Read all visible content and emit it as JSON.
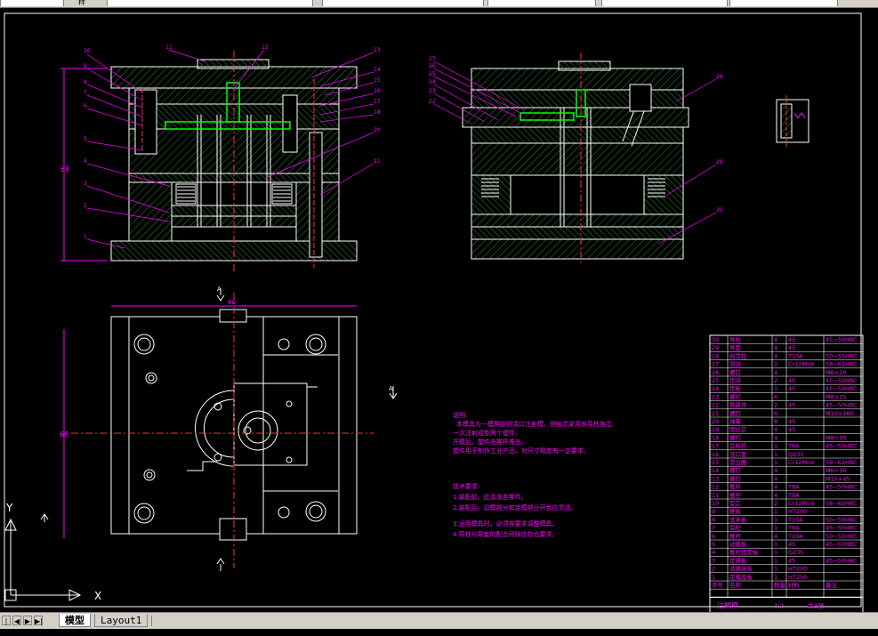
{
  "toolbar": {
    "fragment_label": "样"
  },
  "tabs": [
    {
      "label": "模型"
    },
    {
      "label": "Layout1"
    }
  ],
  "nav_buttons": [
    "|◀",
    "◀",
    "▶",
    "▶|"
  ],
  "ucs": {
    "x_label": "X",
    "y_label": "Y"
  },
  "drawing": {
    "notes_title": "说明:",
    "notes_body": [
      "本模具为一模两腔侧浇口注射模，侧抽芯采用斜导柱抽芯,",
      "一次注射成型两个塑件;",
      "开模后，塑件由推杆推出。",
      "塑件用于制作工业产品，对尺寸精度有一定要求。"
    ],
    "tech_title": "技术要求:",
    "tech_items": [
      "1.装配前，应清洗各零件。",
      "2.装配后，动模部分和定模部分开合应灵活。",
      "3.运用模具时，必须按要求调整模具。",
      "4.导柱与导套的配合间隙应符合要求。"
    ],
    "section_labels": [
      "A",
      "A"
    ],
    "part_numbers_left": [
      "10",
      "9",
      "8",
      "7",
      "6",
      "5",
      "4",
      "3",
      "2",
      "1"
    ],
    "part_numbers_top": [
      "11",
      "12",
      "13"
    ],
    "part_numbers_right": [
      "14",
      "15",
      "16",
      "17",
      "18",
      "19",
      "20",
      "21"
    ],
    "part_numbers_mid": [
      "27",
      "26",
      "25",
      "24",
      "23",
      "22"
    ],
    "part_numbers_mid_right": [
      "28",
      "29",
      "30"
    ]
  },
  "bom": {
    "rows": [
      [
        "30",
        "导柱",
        "4",
        "45",
        "45~50HRC"
      ],
      [
        "29",
        "导套",
        "4",
        "45",
        ""
      ],
      [
        "28",
        "斜导柱",
        "4",
        "T10A",
        "50~55HRC"
      ],
      [
        "27",
        "滑块",
        "2",
        "Cr12MoV",
        "58~62HRC"
      ],
      [
        "26",
        "螺钉",
        "4",
        "",
        "M6×20"
      ],
      [
        "25",
        "垫块",
        "2",
        "45",
        "45~50HRC"
      ],
      [
        "24",
        "垫板",
        "1",
        "45",
        "45~50HRC"
      ],
      [
        "23",
        "螺钉",
        "6",
        "",
        "M8×15"
      ],
      [
        "22",
        "楔紧块",
        "2",
        "45",
        "45~50HRC"
      ],
      [
        "21",
        "螺钉",
        "6",
        "",
        "M10×160"
      ],
      [
        "20",
        "弹簧",
        "8",
        "45",
        ""
      ],
      [
        "19",
        "限位钉",
        "4",
        "45",
        ""
      ],
      [
        "18",
        "螺钉",
        "4",
        "",
        "M8×30"
      ],
      [
        "17",
        "拉料杆",
        "1",
        "T8A",
        "45~50HRC"
      ],
      [
        "16",
        "浇口套",
        "1",
        "Q235",
        ""
      ],
      [
        "15",
        "定位圈",
        "1",
        "Cr12MoV",
        "58~62HRC"
      ],
      [
        "14",
        "螺钉",
        "4",
        "",
        "M6×30"
      ],
      [
        "13",
        "螺钉",
        "4",
        "",
        "M10×45"
      ],
      [
        "12",
        "推杆",
        "4",
        "T8A",
        "45~50HRC"
      ],
      [
        "11",
        "推杆",
        "4",
        "T8A",
        ""
      ],
      [
        "10",
        "型芯",
        "2",
        "Cr12MoV",
        "58~62HRC"
      ],
      [
        "9",
        "推板",
        "1",
        "HT200",
        ""
      ],
      [
        "8",
        "支承板",
        "1",
        "T10A",
        "50~55HRC"
      ],
      [
        "7",
        "型腔",
        "1",
        "T8A",
        "45~50HRC"
      ],
      [
        "6",
        "推杆",
        "4",
        "T10A",
        "50~55HRC"
      ],
      [
        "5",
        "动模板",
        "1",
        "45",
        "45~50HRC"
      ],
      [
        "4",
        "推杆固定板",
        "1",
        "Q235",
        ""
      ],
      [
        "3",
        "定模板",
        "1",
        "45",
        "45~50HRC"
      ],
      [
        "2",
        "动模座板",
        "1",
        "HT200",
        ""
      ],
      [
        "1",
        "定模座板",
        "1",
        "HT200",
        ""
      ]
    ],
    "header": [
      "序号",
      "名称",
      "数量",
      "材料",
      "备注"
    ],
    "title_block": [
      "注塑模",
      "1:2",
      "共1张"
    ]
  },
  "colors": {
    "background": "#000000",
    "outline": "#ffffff",
    "hatch": "#2e8b2e",
    "dimension": "#ff00ff",
    "leader": "#ff00ff",
    "highlight": "#00ff00",
    "yellow": "#ffff00",
    "red": "#ff3030"
  }
}
